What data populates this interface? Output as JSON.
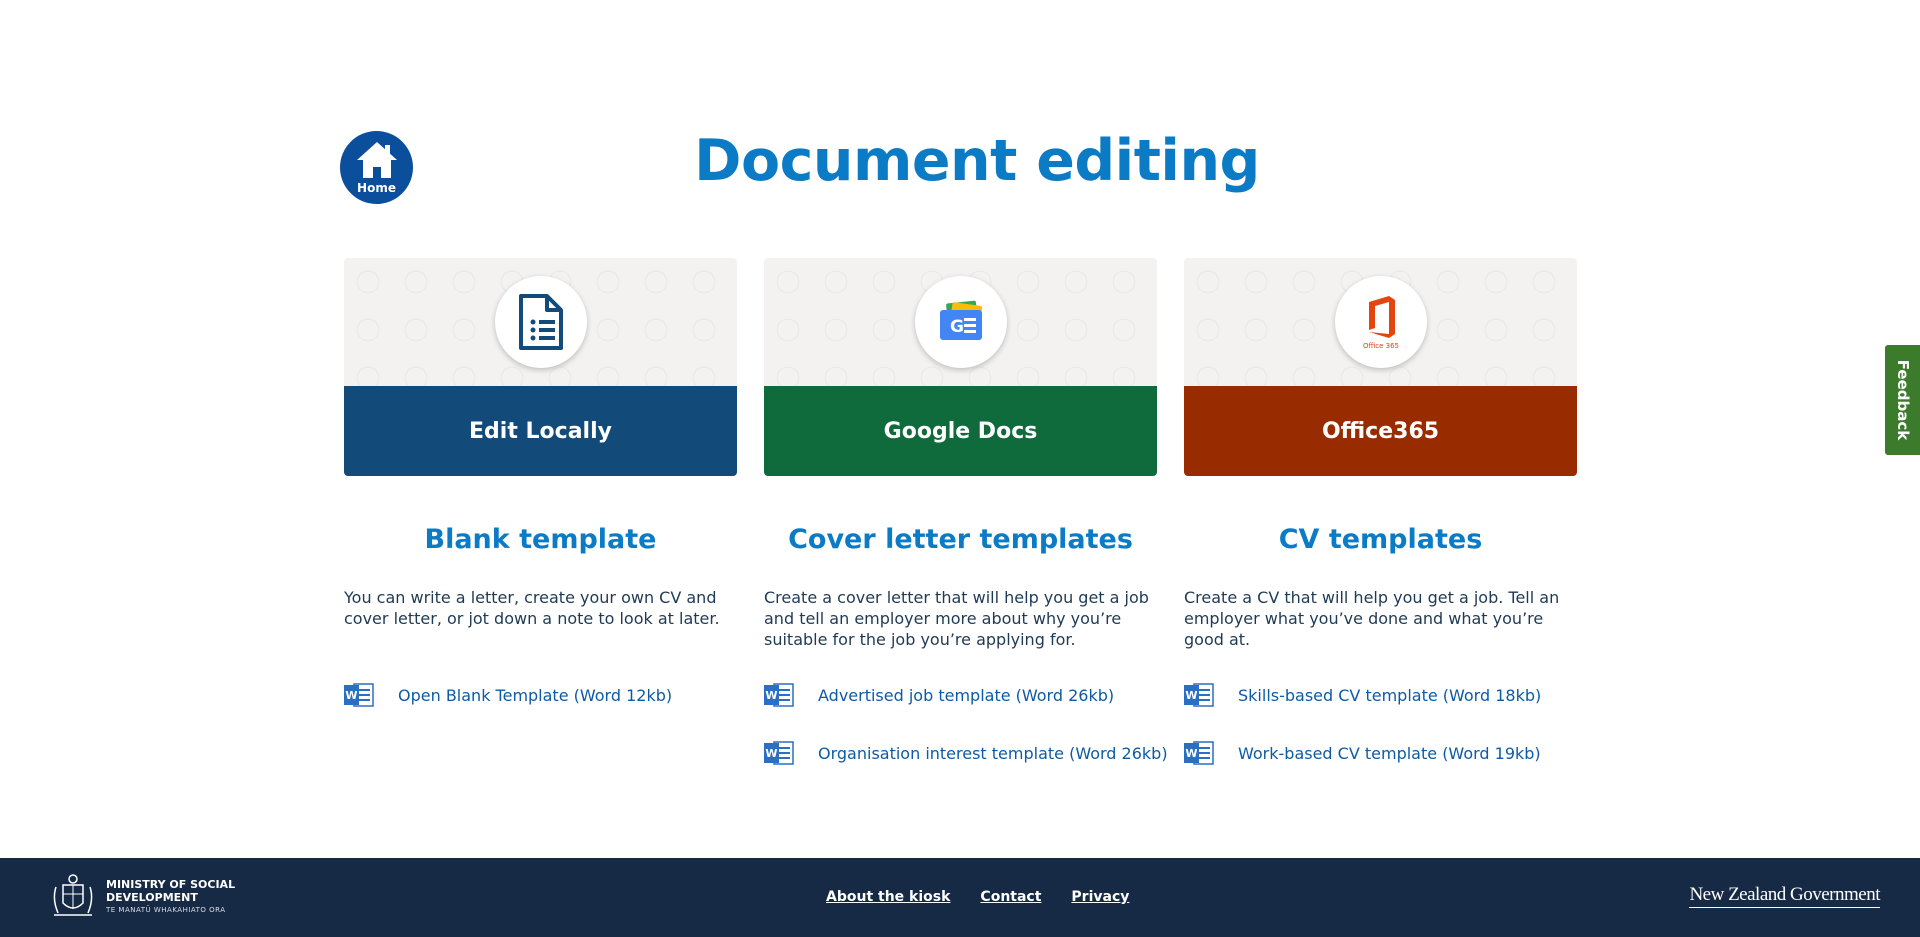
{
  "header": {
    "home_label": "Home",
    "title": "Document editing"
  },
  "cards": [
    {
      "label": "Edit Locally",
      "color": "#124a7a",
      "icon": "document-list-icon"
    },
    {
      "label": "Google Docs",
      "color": "#0f6b3b",
      "icon": "google-docs-icon"
    },
    {
      "label": "Office365",
      "color": "#992b00",
      "icon": "office365-icon",
      "icon_text": "Office 365"
    }
  ],
  "sections": [
    {
      "title": "Blank template",
      "description": "You can write a letter, create your own CV and cover letter, or jot down a note to look at later.",
      "links": [
        "Open Blank Template (Word 12kb)"
      ]
    },
    {
      "title": "Cover letter templates",
      "description": "Create a cover letter that will help you get a job and tell an employer more about why you’re suitable for the job you’re applying for.",
      "links": [
        "Advertised job template (Word 26kb)",
        "Organisation interest template (Word 26kb)"
      ]
    },
    {
      "title": "CV templates",
      "description": "Create a CV that will help you get a job. Tell an employer what you’ve done and what you’re good at.",
      "links": [
        "Skills-based CV template (Word 18kb)",
        "Work-based CV template (Word 19kb)"
      ]
    }
  ],
  "word_icon_letter": "W",
  "feedback": {
    "label": "Feedback",
    "color": "#3c7a2c"
  },
  "footer": {
    "msd_line1": "MINISTRY OF SOCIAL",
    "msd_line2": "DEVELOPMENT",
    "msd_line3": "TE MANATŪ WHAKAHIATO ORA",
    "links": [
      "About the kiosk",
      "Contact",
      "Privacy"
    ],
    "nz_gov": "New Zealand Government"
  }
}
